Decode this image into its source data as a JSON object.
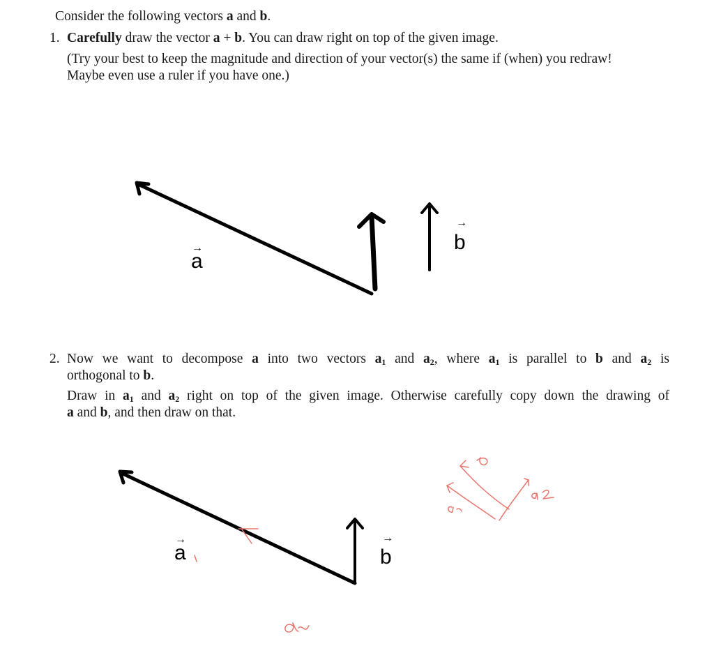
{
  "intro": {
    "prefix": "Consider the following vectors ",
    "a": "a",
    "and": " and ",
    "b": "b",
    "end": "."
  },
  "q1": {
    "number": "1.",
    "bold_word": "Carefully",
    "line1_mid": " draw the vector ",
    "a": "a",
    "plus": " + ",
    "b": "b",
    "line1_end": ". You can draw right on top of the given image.",
    "note_line1": "(Try your best to keep the magnitude and direction of your vector(s) the same if (when) you redraw!",
    "note_line2": "Maybe even use a ruler if you have one.)"
  },
  "q2": {
    "number": "2.",
    "l1_a": "Now we want to decompose ",
    "a": "a",
    "l1_b": " into two vectors ",
    "a1": "a",
    "sub1": "1",
    "and": " and ",
    "a2": "a",
    "sub2": "2",
    "where": ", where ",
    "parallel": " is parallel to ",
    "b": "b",
    "is": " is",
    "l2": "orthogonal to ",
    "l2_end": ".",
    "p2_l1_a": "Draw in ",
    "p2_l1_b": " right on top of the given image. Otherwise carefully copy down the drawing of",
    "p2_l2_b": ", and then draw on that."
  },
  "figure1": {
    "label_a": "a",
    "label_b": "b",
    "arrow_glyph": "→",
    "ink_color": "#000000"
  },
  "figure2": {
    "label_a": "a",
    "label_b": "b",
    "arrow_glyph": "→",
    "ink_color": "#000000",
    "annotation_color": "#e8766f",
    "annotations": {
      "sketch_b": "b",
      "sketch_a1": "a1",
      "sketch_a2": "a2",
      "bottom_a2": "a2"
    }
  }
}
